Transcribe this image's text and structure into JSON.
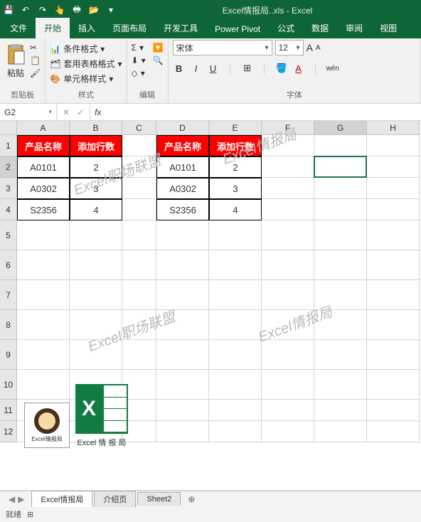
{
  "app": {
    "title": "Excel情报局..xls  -  Excel"
  },
  "qat": {
    "save": "💾",
    "undo": "↶",
    "redo": "↷",
    "touch": "👆",
    "print": "🖶",
    "open": "📂"
  },
  "tabs": {
    "file": "文件",
    "home": "开始",
    "insert": "插入",
    "layout": "页面布局",
    "dev": "开发工具",
    "powerpivot": "Power Pivot",
    "formulas": "公式",
    "data": "数据",
    "review": "审阅",
    "view": "视图"
  },
  "ribbon": {
    "clipboard": {
      "paste": "粘贴",
      "group": "剪贴板"
    },
    "styles": {
      "cond": "条件格式",
      "table": "套用表格格式",
      "cell": "单元格样式",
      "group": "样式"
    },
    "editing": {
      "sigma": "Σ",
      "fill": "⬇",
      "clear": "◇",
      "group": "编辑"
    },
    "font": {
      "name": "宋体",
      "size": "12",
      "inc": "A",
      "dec": "A",
      "bold": "B",
      "italic": "I",
      "underline": "U",
      "border": "⊞",
      "fill": "🪣",
      "color": "A",
      "phonetic": "wén",
      "group": "字体"
    }
  },
  "nameBox": "G2",
  "fx": {
    "cancel": "✕",
    "confirm": "✓",
    "label": "fx",
    "value": ""
  },
  "columns": [
    "A",
    "B",
    "C",
    "D",
    "E",
    "F",
    "G",
    "H"
  ],
  "rowCount": 12,
  "table1": {
    "headers": [
      "产品名称",
      "添加行数"
    ],
    "rows": [
      [
        "A0101",
        "2"
      ],
      [
        "A0302",
        "3"
      ],
      [
        "S2356",
        "4"
      ]
    ]
  },
  "table2": {
    "headers": [
      "产品名称",
      "添加行数"
    ],
    "rows": [
      [
        "A0101",
        "2"
      ],
      [
        "A0302",
        "3"
      ],
      [
        "S2356",
        "4"
      ]
    ]
  },
  "watermarks": [
    "Excel情报局",
    "Excel职场联盟",
    "Excel职场联盟",
    "Excel情报局"
  ],
  "logoLabel": "Excel 情 报 局",
  "avatarLabel": "Excel情报局",
  "sheets": {
    "active": "Excel情报局",
    "others": [
      "介绍页",
      "Sheet2"
    ],
    "add": "⊕"
  },
  "status": {
    "ready": "就绪",
    "icon": "⊞"
  }
}
